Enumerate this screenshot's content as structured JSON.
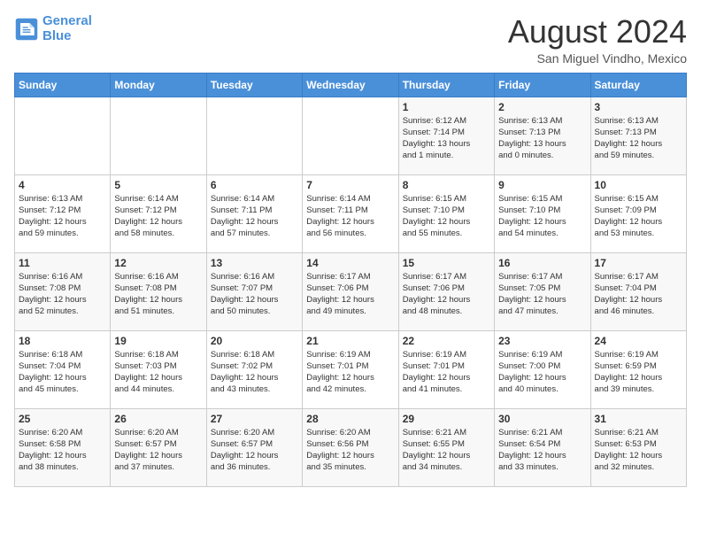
{
  "header": {
    "logo_line1": "General",
    "logo_line2": "Blue",
    "title": "August 2024",
    "subtitle": "San Miguel Vindho, Mexico"
  },
  "calendar": {
    "weekdays": [
      "Sunday",
      "Monday",
      "Tuesday",
      "Wednesday",
      "Thursday",
      "Friday",
      "Saturday"
    ],
    "weeks": [
      [
        {
          "day": "",
          "info": ""
        },
        {
          "day": "",
          "info": ""
        },
        {
          "day": "",
          "info": ""
        },
        {
          "day": "",
          "info": ""
        },
        {
          "day": "1",
          "info": "Sunrise: 6:12 AM\nSunset: 7:14 PM\nDaylight: 13 hours\nand 1 minute."
        },
        {
          "day": "2",
          "info": "Sunrise: 6:13 AM\nSunset: 7:13 PM\nDaylight: 13 hours\nand 0 minutes."
        },
        {
          "day": "3",
          "info": "Sunrise: 6:13 AM\nSunset: 7:13 PM\nDaylight: 12 hours\nand 59 minutes."
        }
      ],
      [
        {
          "day": "4",
          "info": "Sunrise: 6:13 AM\nSunset: 7:12 PM\nDaylight: 12 hours\nand 59 minutes."
        },
        {
          "day": "5",
          "info": "Sunrise: 6:14 AM\nSunset: 7:12 PM\nDaylight: 12 hours\nand 58 minutes."
        },
        {
          "day": "6",
          "info": "Sunrise: 6:14 AM\nSunset: 7:11 PM\nDaylight: 12 hours\nand 57 minutes."
        },
        {
          "day": "7",
          "info": "Sunrise: 6:14 AM\nSunset: 7:11 PM\nDaylight: 12 hours\nand 56 minutes."
        },
        {
          "day": "8",
          "info": "Sunrise: 6:15 AM\nSunset: 7:10 PM\nDaylight: 12 hours\nand 55 minutes."
        },
        {
          "day": "9",
          "info": "Sunrise: 6:15 AM\nSunset: 7:10 PM\nDaylight: 12 hours\nand 54 minutes."
        },
        {
          "day": "10",
          "info": "Sunrise: 6:15 AM\nSunset: 7:09 PM\nDaylight: 12 hours\nand 53 minutes."
        }
      ],
      [
        {
          "day": "11",
          "info": "Sunrise: 6:16 AM\nSunset: 7:08 PM\nDaylight: 12 hours\nand 52 minutes."
        },
        {
          "day": "12",
          "info": "Sunrise: 6:16 AM\nSunset: 7:08 PM\nDaylight: 12 hours\nand 51 minutes."
        },
        {
          "day": "13",
          "info": "Sunrise: 6:16 AM\nSunset: 7:07 PM\nDaylight: 12 hours\nand 50 minutes."
        },
        {
          "day": "14",
          "info": "Sunrise: 6:17 AM\nSunset: 7:06 PM\nDaylight: 12 hours\nand 49 minutes."
        },
        {
          "day": "15",
          "info": "Sunrise: 6:17 AM\nSunset: 7:06 PM\nDaylight: 12 hours\nand 48 minutes."
        },
        {
          "day": "16",
          "info": "Sunrise: 6:17 AM\nSunset: 7:05 PM\nDaylight: 12 hours\nand 47 minutes."
        },
        {
          "day": "17",
          "info": "Sunrise: 6:17 AM\nSunset: 7:04 PM\nDaylight: 12 hours\nand 46 minutes."
        }
      ],
      [
        {
          "day": "18",
          "info": "Sunrise: 6:18 AM\nSunset: 7:04 PM\nDaylight: 12 hours\nand 45 minutes."
        },
        {
          "day": "19",
          "info": "Sunrise: 6:18 AM\nSunset: 7:03 PM\nDaylight: 12 hours\nand 44 minutes."
        },
        {
          "day": "20",
          "info": "Sunrise: 6:18 AM\nSunset: 7:02 PM\nDaylight: 12 hours\nand 43 minutes."
        },
        {
          "day": "21",
          "info": "Sunrise: 6:19 AM\nSunset: 7:01 PM\nDaylight: 12 hours\nand 42 minutes."
        },
        {
          "day": "22",
          "info": "Sunrise: 6:19 AM\nSunset: 7:01 PM\nDaylight: 12 hours\nand 41 minutes."
        },
        {
          "day": "23",
          "info": "Sunrise: 6:19 AM\nSunset: 7:00 PM\nDaylight: 12 hours\nand 40 minutes."
        },
        {
          "day": "24",
          "info": "Sunrise: 6:19 AM\nSunset: 6:59 PM\nDaylight: 12 hours\nand 39 minutes."
        }
      ],
      [
        {
          "day": "25",
          "info": "Sunrise: 6:20 AM\nSunset: 6:58 PM\nDaylight: 12 hours\nand 38 minutes."
        },
        {
          "day": "26",
          "info": "Sunrise: 6:20 AM\nSunset: 6:57 PM\nDaylight: 12 hours\nand 37 minutes."
        },
        {
          "day": "27",
          "info": "Sunrise: 6:20 AM\nSunset: 6:57 PM\nDaylight: 12 hours\nand 36 minutes."
        },
        {
          "day": "28",
          "info": "Sunrise: 6:20 AM\nSunset: 6:56 PM\nDaylight: 12 hours\nand 35 minutes."
        },
        {
          "day": "29",
          "info": "Sunrise: 6:21 AM\nSunset: 6:55 PM\nDaylight: 12 hours\nand 34 minutes."
        },
        {
          "day": "30",
          "info": "Sunrise: 6:21 AM\nSunset: 6:54 PM\nDaylight: 12 hours\nand 33 minutes."
        },
        {
          "day": "31",
          "info": "Sunrise: 6:21 AM\nSunset: 6:53 PM\nDaylight: 12 hours\nand 32 minutes."
        }
      ]
    ]
  }
}
